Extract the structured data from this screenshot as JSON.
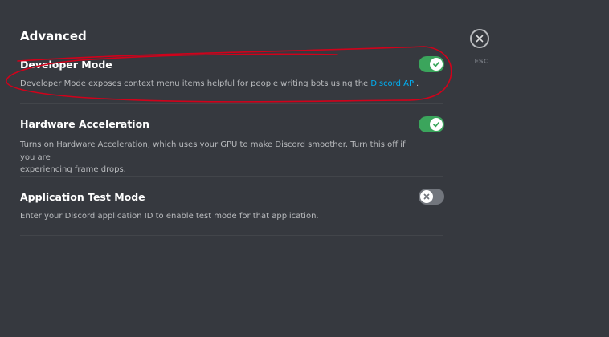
{
  "section": {
    "title": "Advanced"
  },
  "settings": [
    {
      "title": "Developer Mode",
      "description_prefix": "Developer Mode exposes context menu items helpful for people writing bots using the ",
      "link_text": "Discord API",
      "description_suffix": ".",
      "enabled": true
    },
    {
      "title": "Hardware Acceleration",
      "description_line1": "Turns on Hardware Acceleration, which uses your GPU to make Discord smoother. Turn this off if you are",
      "description_line2": "experiencing frame drops.",
      "enabled": true
    },
    {
      "title": "Application Test Mode",
      "description": "Enter your Discord application ID to enable test mode for that application.",
      "enabled": false
    }
  ],
  "close": {
    "label": "ESC"
  },
  "colors": {
    "background": "#36393f",
    "toggle_on": "#3ba55c",
    "toggle_off": "#72767d",
    "link": "#00b0f4",
    "annotation": "#d0021b"
  },
  "icons": {
    "check": "check-icon",
    "cross": "x-icon",
    "close": "close-icon"
  }
}
